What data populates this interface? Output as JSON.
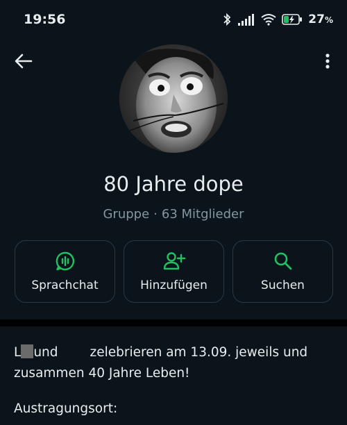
{
  "status_bar": {
    "time": "19:56",
    "battery": "27",
    "battery_unit": "%",
    "icons": [
      "bluetooth-icon",
      "signal-icon",
      "wifi-icon",
      "battery-charging-icon"
    ]
  },
  "group": {
    "name": "80 Jahre dope",
    "type": "Gruppe",
    "separator": "·",
    "members": "63 Mitglieder"
  },
  "actions": [
    {
      "label": "Sprachchat",
      "icon": "voice-chat-icon"
    },
    {
      "label": "Hinzufügen",
      "icon": "add-person-icon"
    },
    {
      "label": "Suchen",
      "icon": "search-icon"
    }
  ],
  "description": {
    "prefix": "L",
    "word_und": "und",
    "text": "zelebrieren am 13.09. jeweils und zusammen 40 Jahre Leben!"
  },
  "location_label": "Austragungsort:",
  "colors": {
    "background": "#0b141a",
    "accent": "#21c063",
    "text": "#e9edef",
    "muted": "#8696a0"
  }
}
